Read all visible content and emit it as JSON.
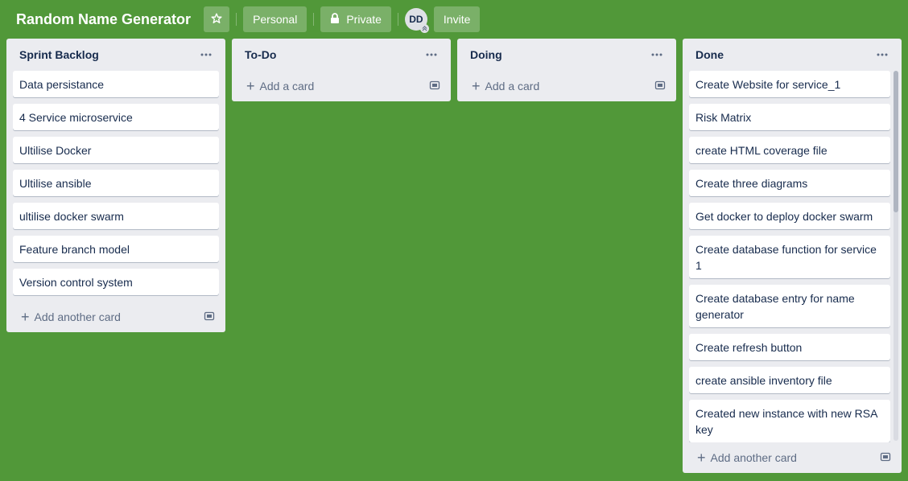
{
  "board": {
    "title": "Random Name Generator",
    "personal_label": "Personal",
    "visibility_label": "Private",
    "avatar_initials": "DD",
    "invite_label": "Invite"
  },
  "lists": [
    {
      "title": "Sprint Backlog",
      "cards": [
        "Data persistance",
        "4 Service microservice",
        "Ultilise Docker",
        "Ultilise ansible",
        "ultilise docker swarm",
        "Feature branch model",
        "Version control system"
      ],
      "add_label": "Add another card"
    },
    {
      "title": "To-Do",
      "cards": [],
      "add_label": "Add a card"
    },
    {
      "title": "Doing",
      "cards": [],
      "add_label": "Add a card"
    },
    {
      "title": "Done",
      "cards": [
        "Create Website for service_1",
        "Risk Matrix",
        "create HTML coverage file",
        "Create three diagrams",
        "Get docker to deploy docker swarm",
        "Create database function for service 1",
        "Create database entry for name generator",
        "Create refresh button",
        "create ansible inventory file",
        "Created new instance with new RSA key"
      ],
      "add_label": "Add another card"
    }
  ],
  "colors": {
    "board_background": "#519839",
    "list_background": "#ebecf0",
    "card_background": "#ffffff",
    "text": "#172b4d"
  }
}
